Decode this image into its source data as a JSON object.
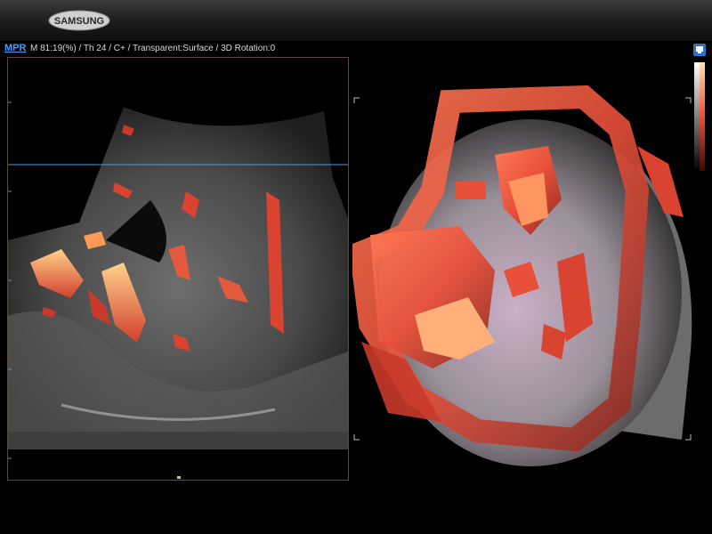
{
  "header": {
    "brand": "SAMSUNG"
  },
  "statusbar": {
    "mode": "MPR",
    "info": "M 81:19(%) / Th 24 / C+ / Transparent:Surface / 3D Rotation:0"
  },
  "icons": {
    "device": "device-icon"
  },
  "colors": {
    "accent": "#3da0ff",
    "flow": "#e8503a",
    "flow_bright": "#ffc27a"
  }
}
